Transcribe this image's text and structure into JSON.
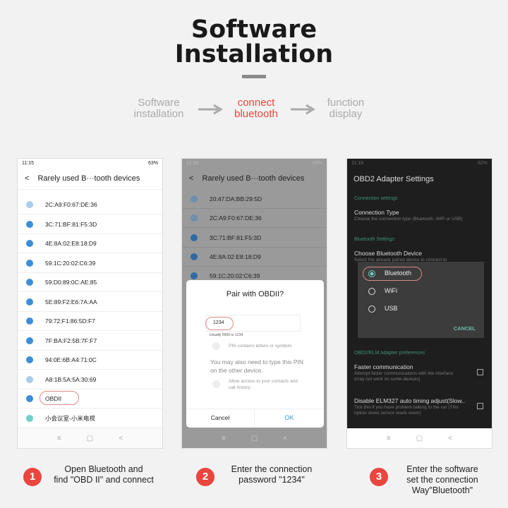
{
  "header": {
    "title_line1": "Software",
    "title_line2": "Installation"
  },
  "steps": [
    {
      "label": "Software\ninstallation",
      "active": false
    },
    {
      "label": "connect\nbluetooth",
      "active": true
    },
    {
      "label": "function\ndisplay",
      "active": false
    }
  ],
  "colors": {
    "accent": "#e8463e",
    "step_inactive": "#aaaaaa",
    "teal": "#3f8f7a"
  },
  "phone1": {
    "time": "11:15",
    "battery": "63%",
    "title": "Rarely used B···tooth devices",
    "devices": [
      {
        "name": "2C:A9:F0:67:DE:36",
        "icon": "light"
      },
      {
        "name": "3C:71:BF:81:F5:3D",
        "icon": "bt"
      },
      {
        "name": "4E:8A:02:E8:18:D9",
        "icon": "bt"
      },
      {
        "name": "59:1C:20:02:C6:39",
        "icon": "bt"
      },
      {
        "name": "59:D0:89:0C:AE:85",
        "icon": "bt"
      },
      {
        "name": "5E:89:F2:E6:7A:AA",
        "icon": "bt"
      },
      {
        "name": "79:72:F1:86:5D:F7",
        "icon": "bt"
      },
      {
        "name": "7F:BA:F2:5B:7F:F7",
        "icon": "bt"
      },
      {
        "name": "94:0E:6B:A4:71:0C",
        "icon": "bt"
      },
      {
        "name": "A8:1B:5A:5A:30:69",
        "icon": "light"
      },
      {
        "name": "OBDII",
        "icon": "bt"
      },
      {
        "name": "小会议室-小米电视",
        "icon": "tv"
      }
    ]
  },
  "phone2": {
    "time": "11:15",
    "battery": "63%",
    "title": "Rarely used B···tooth devices",
    "devices": [
      "20:47:DA:BB:29:5D",
      "2C:A9:F0:67:DE:36",
      "3C:71:BF:81:F5:3D",
      "4E:8A:02:E8:18:D9",
      "59:1C:20:02:C6:39"
    ],
    "dialog": {
      "title": "Pair with OBDII?",
      "pin": "1234",
      "hint": "Usually 0000 or 1234",
      "pin_letters": "PIN contains letters or symbols",
      "note": "You may also need to type this PIN on the other device.",
      "allow": "Allow access to your contacts and call history",
      "cancel": "Cancel",
      "ok": "OK"
    }
  },
  "phone3": {
    "time": "11:16",
    "battery": "62%",
    "title": "OBD2 Adapter Settings",
    "sec_connection": "Connection settings",
    "conn_type": "Connection Type",
    "conn_type_desc": "Choose the connection type (Bluetooth, WiFi or USB)",
    "sec_bt": "Bluetooth Settings",
    "choose_bt": "Choose Bluetooth Device",
    "choose_bt_desc": "Select the already paired device to connect to",
    "sec_pref": "OBD2/ELM Adapter preferences",
    "faster": "Faster communication",
    "faster_desc": "Attempt faster communications with the interface (may not work on some devices)",
    "disable": "Disable ELM327 auto timing adjust(Slow..",
    "disable_desc": "Tick this if you have problem talking to the car (This option slows sensor reads down)",
    "dialog": {
      "options": [
        "Bluetooth",
        "WiFi",
        "USB"
      ],
      "selected": "Bluetooth",
      "cancel": "CANCEL"
    }
  },
  "captions": [
    {
      "num": "1",
      "text": "Open Bluetooth and\nfind \"OBD II\" and connect"
    },
    {
      "num": "2",
      "text": "Enter the connection\npassword \"1234\""
    },
    {
      "num": "3",
      "text": "Enter the software\nset the connection\nWay\"Bluetooth\""
    }
  ]
}
